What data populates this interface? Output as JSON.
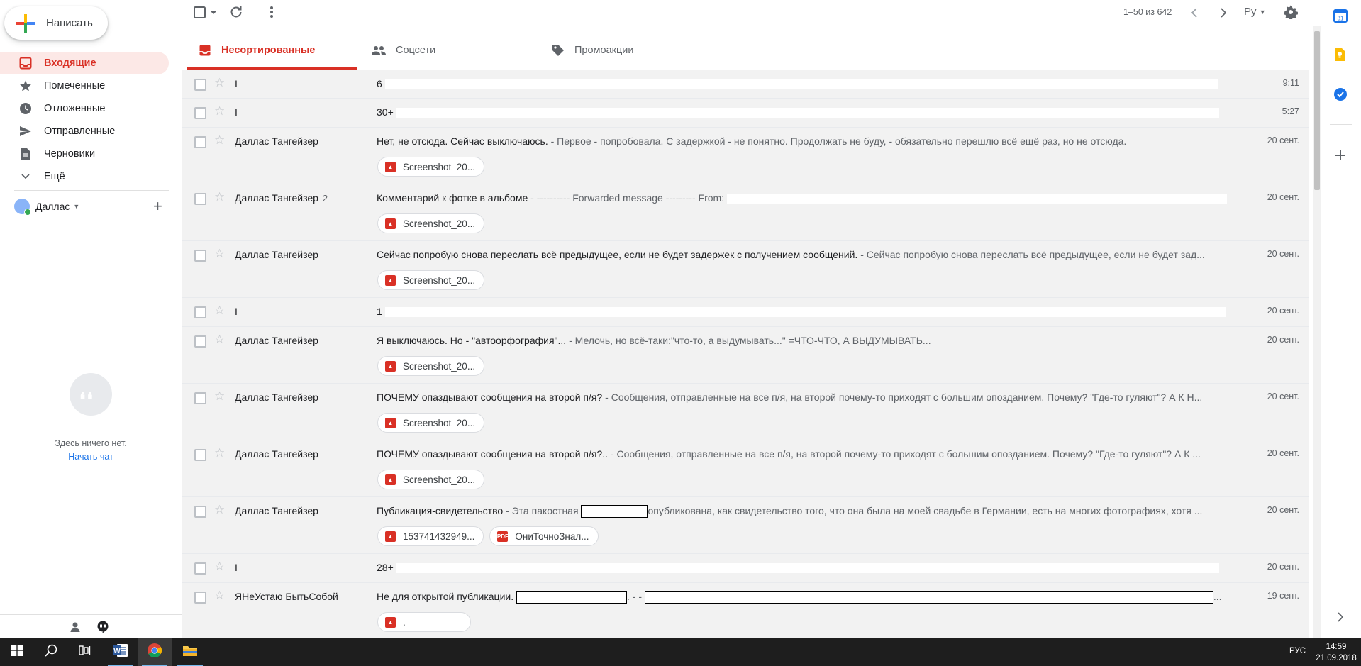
{
  "compose": {
    "label": "Написать"
  },
  "nav": [
    {
      "label": "Входящие"
    },
    {
      "label": "Помеченные"
    },
    {
      "label": "Отложенные"
    },
    {
      "label": "Отправленные"
    },
    {
      "label": "Черновики"
    },
    {
      "label": "Ещё"
    }
  ],
  "account": {
    "name": "Даллас"
  },
  "chat": {
    "empty_text": "Здесь ничего нет.",
    "start_link": "Начать чат"
  },
  "toolbar": {
    "page_count": "1–50 из 642",
    "language": "Ру"
  },
  "tabs": [
    {
      "label": "Несортированные"
    },
    {
      "label": "Соцсети"
    },
    {
      "label": "Промоакции"
    }
  ],
  "emails": [
    {
      "sender": "I",
      "count": "",
      "subject": "6",
      "snippet": "",
      "date": "9:11",
      "attachments": []
    },
    {
      "sender": "I",
      "count": "",
      "subject": "30+",
      "snippet": "",
      "date": "5:27",
      "attachments": []
    },
    {
      "sender": "Даллас Тангейзер",
      "count": "",
      "subject": "Нет, не отсюда. Сейчас выключаюсь.",
      "snippet": " - Первое - попробовала. С задержкой - не понятно. Продолжать не буду, - обязательно перешлю всё ещё раз, но не отсюда.",
      "date": "20 сент.",
      "attachments": [
        "Screenshot_20..."
      ]
    },
    {
      "sender": "Даллас Тангейзер",
      "count": "2",
      "subject": "Комментарий к фотке в альбоме",
      "snippet": " - ---------- Forwarded message --------- From:",
      "date": "20 сент.",
      "attachments": [
        "Screenshot_20..."
      ]
    },
    {
      "sender": "Даллас Тангейзер",
      "count": "",
      "subject": "Сейчас попробую снова переслать всё предыдущее, если не будет задержек с получением сообщений.",
      "snippet": " - Сейчас попробую снова переслать всё предыдущее, если не будет зад...",
      "date": "20 сент.",
      "attachments": [
        "Screenshot_20..."
      ]
    },
    {
      "sender": "I",
      "count": "",
      "subject": "1",
      "snippet": "",
      "date": "20 сент.",
      "attachments": []
    },
    {
      "sender": "Даллас Тангейзер",
      "count": "",
      "subject": "Я выключаюсь. Но - \"автоорфография\"...",
      "snippet": " - Мелочь, но всё-таки:\"что-то, а выдумывать...\" =ЧТО-ЧТО, А ВЫДУМЫВАТЬ...",
      "date": "20 сент.",
      "attachments": [
        "Screenshot_20..."
      ]
    },
    {
      "sender": "Даллас Тангейзер",
      "count": "",
      "subject": "ПОЧЕМУ опаздывают сообщения на второй п/я?",
      "snippet": " - Сообщения, отправленные на все п/я, на второй почему-то приходят с большим опозданием. Почему? \"Где-то гуляют\"? А К Н...",
      "date": "20 сент.",
      "attachments": [
        "Screenshot_20..."
      ]
    },
    {
      "sender": "Даллас Тангейзер",
      "count": "",
      "subject": "ПОЧЕМУ опаздывают сообщения на второй п/я?..",
      "snippet": " - Сообщения, отправленные на все п/я, на второй почему-то приходят с большим опозданием. Почему? \"Где-то гуляют\"? А К ...",
      "date": "20 сент.",
      "attachments": [
        "Screenshot_20..."
      ]
    },
    {
      "sender": "Даллас Тангейзер",
      "count": "",
      "subject": "Публикация-свидетельство",
      "snippet": " - Эта пакостная",
      "snippet2": "опубликована, как свидетельство того, что она была на моей свадьбе в Германии, есть на многих фотографиях, хотя ...",
      "date": "20 сент.",
      "attachments": [
        "153741432949...",
        "ОниТочноЗнал..."
      ]
    },
    {
      "sender": "I",
      "count": "",
      "subject": "28+",
      "snippet": "",
      "date": "20 сент.",
      "attachments": []
    },
    {
      "sender": "ЯНеУстаю БытьСобой",
      "count": "",
      "subject": "Не для открытой публикации.",
      "snippet": ". - -",
      "snippet2": "...",
      "date": "19 сент.",
      "attachments": [
        "."
      ]
    }
  ],
  "taskbar": {
    "language": "РУС",
    "time": "14:59",
    "date": "21.09.2018"
  },
  "colors": {
    "accent": "#d93025",
    "active_nav_bg": "#fce8e6",
    "row_bg": "#f2f2f2"
  }
}
